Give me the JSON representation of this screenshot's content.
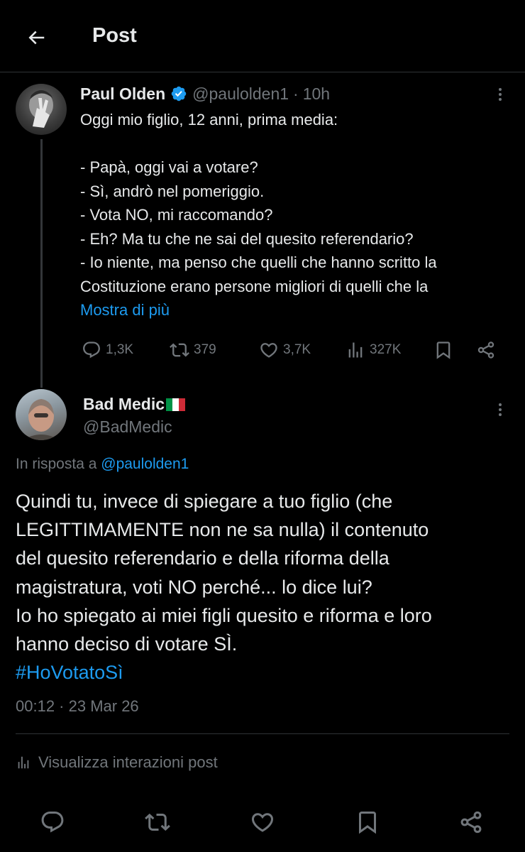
{
  "header": {
    "title": "Post"
  },
  "parent_post": {
    "author_name": "Paul Olden",
    "handle": "@paulolden1",
    "separator": "·",
    "time": "10h",
    "text_lines": [
      "Oggi mio figlio, 12 anni, prima media:",
      "",
      "- Papà, oggi vai a votare?",
      "- Sì, andrò nel pomeriggio.",
      "- Vota NO, mi raccomando?",
      "- Eh? Ma tu che ne sai del quesito referendario?",
      "- Io niente, ma penso che quelli che hanno scritto la",
      "Costituzione erano persone migliori di quelli che la"
    ],
    "show_more": "Mostra di più",
    "stats": {
      "replies": "1,3K",
      "reposts": "379",
      "likes": "3,7K",
      "views": "327K"
    },
    "icons": [
      "reply-icon",
      "repost-icon",
      "like-icon",
      "views-icon",
      "bookmark-icon",
      "share-icon"
    ]
  },
  "reply_post": {
    "author_name": "Bad Medic",
    "flag_colors": [
      "#009246",
      "#ffffff",
      "#ce2b37"
    ],
    "handle": "@BadMedic",
    "reply_prefix": "In risposta a",
    "reply_mention": "@paulolden1",
    "text_lines": [
      "Quindi tu, invece di spiegare a tuo figlio (che",
      "LEGITTIMAMENTE non ne sa nulla) il contenuto",
      "del quesito referendario e della riforma della",
      "magistratura, voti NO perché... lo dice lui?",
      "Io ho spiegato ai miei figli quesito e riforma e loro",
      "hanno deciso di votare SÌ."
    ],
    "hashtag": "#HoVotatoSì",
    "timestamp": "00:12 · 23 Mar 26",
    "view_interactions": "Visualizza interazioni post"
  },
  "colors": {
    "background": "#000000",
    "text": "#e7e9ea",
    "secondary": "#71767b",
    "accent": "#1d9bf0",
    "divider": "#2f3336"
  }
}
